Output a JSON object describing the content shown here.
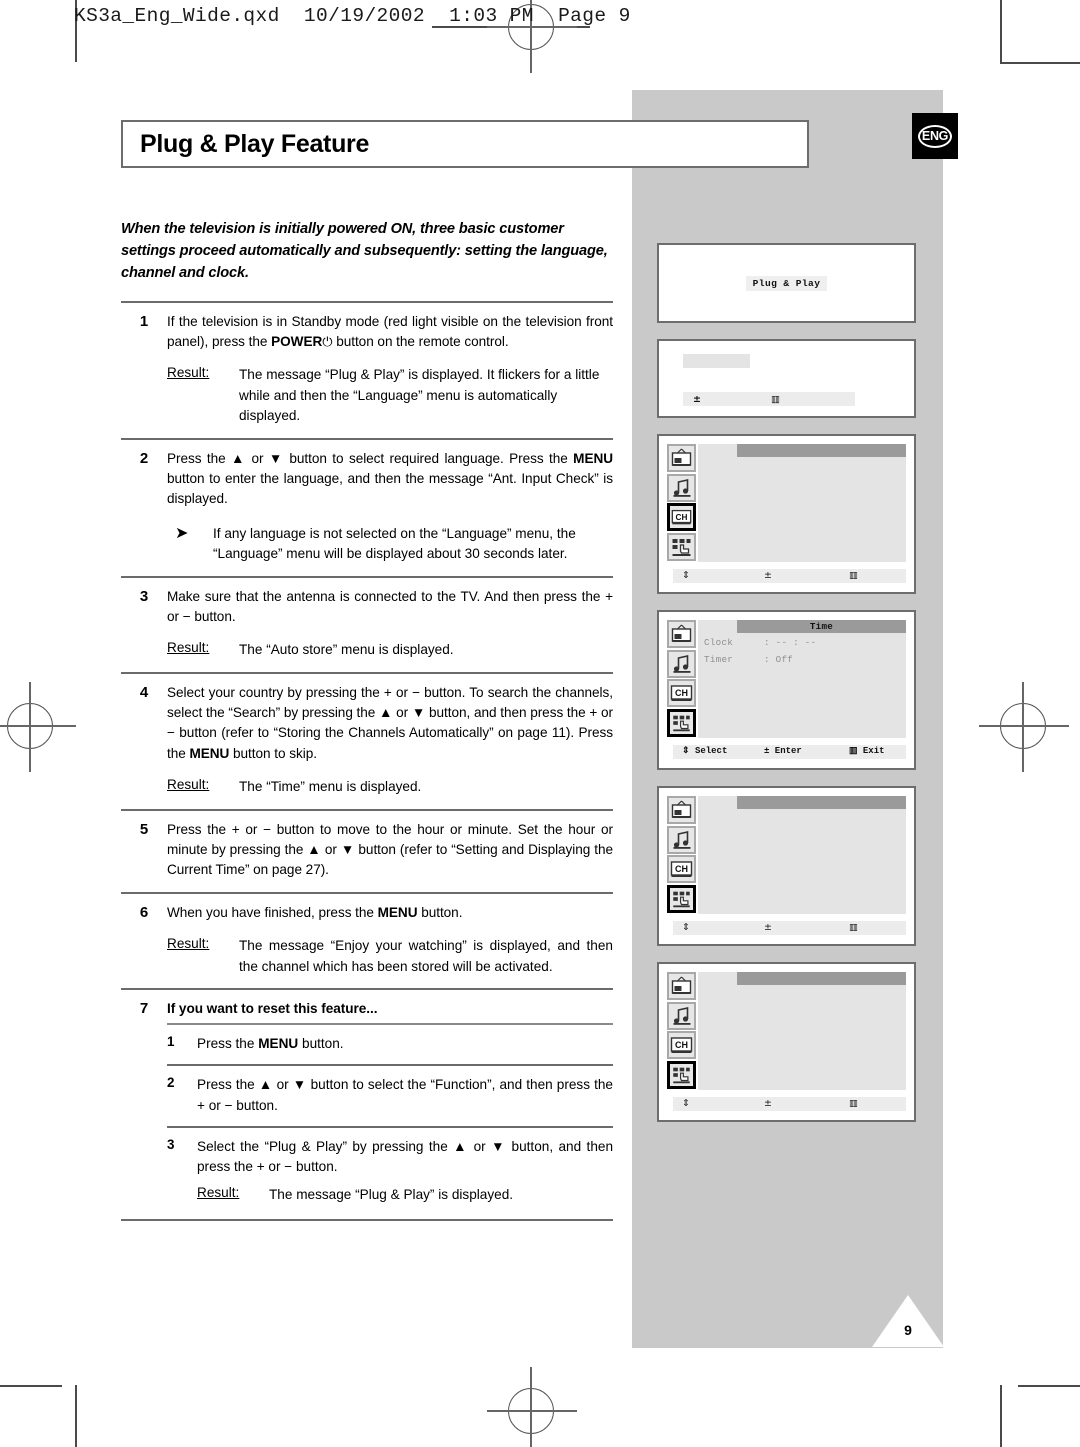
{
  "file_header": "KS3a_Eng_Wide.qxd  10/19/2002  1:03 PM  Page 9",
  "language_badge": "ENG",
  "page_number": "9",
  "title": "Plug & Play Feature",
  "intro": "When the television is initially powered ON, three basic customer settings proceed automatically and subsequently: setting the language, channel and clock.",
  "result_label": "Result:",
  "steps": [
    {
      "num": "1",
      "text_a": "If the television is in Standby mode (red light visible on the television front panel), press the ",
      "bold_b": "POWER",
      "power_icon": "⏻",
      "text_c": " button on the remote control.",
      "result": "The message “Plug & Play” is displayed. It flickers for a little while and then the “Language” menu is automatically displayed."
    },
    {
      "num": "2",
      "text_a": "Press the ▲ or ▼ button to select required language. Press the ",
      "bold_b": "MENU",
      "text_c": " button to enter the language, and then the message “Ant. Input Check” is displayed.",
      "note": "If any language is not selected on the “Language” menu, the “Language” menu will be displayed about 30 seconds later."
    },
    {
      "num": "3",
      "text_a": "Make sure that the antenna is connected to the TV. And then press the + or − button.",
      "result": "The “Auto store” menu is displayed."
    },
    {
      "num": "4",
      "text_a": "Select your country by pressing the + or − button. To search the channels, select the “Search” by pressing the ▲ or ▼ button, and then press the + or − button (refer to “Storing the Channels Automatically” on page 11). Press the ",
      "bold_b": "MENU",
      "text_c": " button to skip.",
      "result": "The “Time” menu is displayed."
    },
    {
      "num": "5",
      "text_a": "Press the + or − button to move to the hour or minute. Set the hour or minute by pressing the ▲ or ▼ button (refer to “Setting and Displaying the Current Time” on page 27)."
    },
    {
      "num": "6",
      "text_a": "When you have finished, press the ",
      "bold_b": "MENU",
      "text_c": " button.",
      "result": "The message “Enjoy your watching” is displayed, and then the channel which has been stored will be activated."
    },
    {
      "num": "7",
      "heading": "If you want to reset this feature...",
      "substeps": [
        {
          "num": "1",
          "text_a": "Press the ",
          "bold_b": "MENU",
          "text_c": " button."
        },
        {
          "num": "2",
          "text_a": "Press the ▲ or ▼ button to select the “Function”, and then press the + or − button."
        },
        {
          "num": "3",
          "text_a": "Select the “Plug & Play” by pressing the ▲ or ▼ button, and then press the + or − button.",
          "result": "The message “Plug & Play” is displayed."
        }
      ]
    }
  ],
  "screens": [
    {
      "id": "screen-plug-play-message",
      "kind": "message",
      "message": "Plug & Play"
    },
    {
      "id": "screen-language-blank",
      "kind": "ghost",
      "nav_left": "±",
      "nav_right": "▥"
    },
    {
      "id": "screen-channel-menu",
      "kind": "menu",
      "selected_icon": 2,
      "title": "",
      "rows": [],
      "nav": {
        "select": "⇕",
        "enter": "±",
        "exit": "▥"
      },
      "nav_labeled": false
    },
    {
      "id": "screen-time-menu",
      "kind": "menu",
      "selected_icon": 3,
      "title": "Time",
      "rows": [
        {
          "key": "Clock",
          "value": ": -- : --"
        },
        {
          "key": "Timer",
          "value": ": Off"
        }
      ],
      "nav": {
        "select": "⇕ Select",
        "enter": "± Enter",
        "exit": "▥ Exit"
      },
      "nav_labeled": true
    },
    {
      "id": "screen-function-menu-1",
      "kind": "menu",
      "selected_icon": 3,
      "title": "",
      "rows": [],
      "nav": {
        "select": "⇕",
        "enter": "±",
        "exit": "▥"
      },
      "nav_labeled": false
    },
    {
      "id": "screen-function-menu-2",
      "kind": "menu",
      "selected_icon": 3,
      "title": "",
      "rows": [],
      "nav": {
        "select": "⇕",
        "enter": "±",
        "exit": "▥"
      },
      "nav_labeled": false
    }
  ],
  "menu_icons": [
    "picture-tv-icon",
    "sound-note-icon",
    "channel-ch-icon",
    "function-setup-icon"
  ]
}
